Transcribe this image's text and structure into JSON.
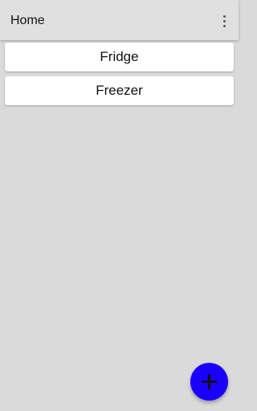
{
  "app_bar": {
    "title": "Home",
    "menu_icon": "more-vert-icon"
  },
  "list": {
    "items": [
      {
        "label": "Fridge"
      },
      {
        "label": "Freezer"
      }
    ]
  },
  "fab": {
    "icon": "add-icon",
    "color": "#1a00ff"
  }
}
